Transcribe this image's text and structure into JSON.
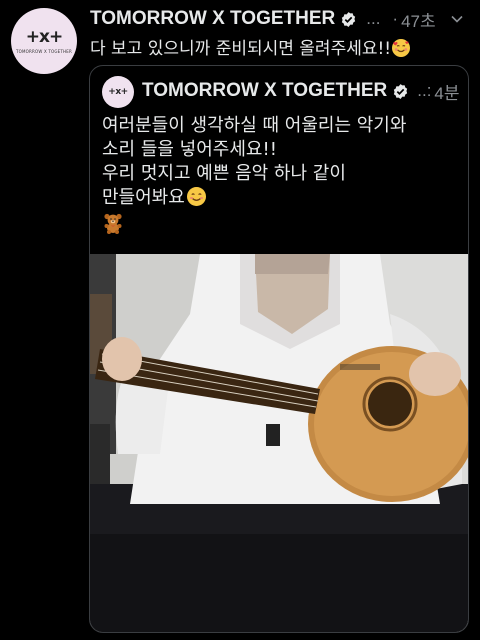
{
  "tweet": {
    "display_name": "TOMORROW X TOGETHER",
    "handle_ellipsis": "...",
    "separator": "·",
    "time": "47초",
    "text": "다 보고 있으니까 준비되시면 올려주세요!!",
    "avatar": {
      "logo": "+x+",
      "subtitle": "TOMORROW X TOGETHER"
    }
  },
  "quote": {
    "display_name": "TOMORROW X TOGETHER",
    "handle_ellipsis": "..:",
    "time": "4분",
    "avatar_logo": "+x+",
    "lines": [
      "여러분들이 생각하실 때 어울리는 악기와",
      "소리 들을 넣어주세요!!",
      "우리 멋지고 예쁜 음악 하나 같이",
      "만들어봐요"
    ]
  },
  "icons": {
    "verified": "verified-badge-icon",
    "more": "more-chevron-icon",
    "emoji_heart_face": "smiling-face-with-hearts-emoji",
    "emoji_smile": "smiling-face-emoji",
    "emoji_bear": "teddy-bear-emoji"
  },
  "colors": {
    "background": "#000000",
    "text_primary": "#e7e9ea",
    "text_secondary": "#8b8f94",
    "card_border": "#3a3d41",
    "avatar_bg": "#f0e2ef"
  }
}
